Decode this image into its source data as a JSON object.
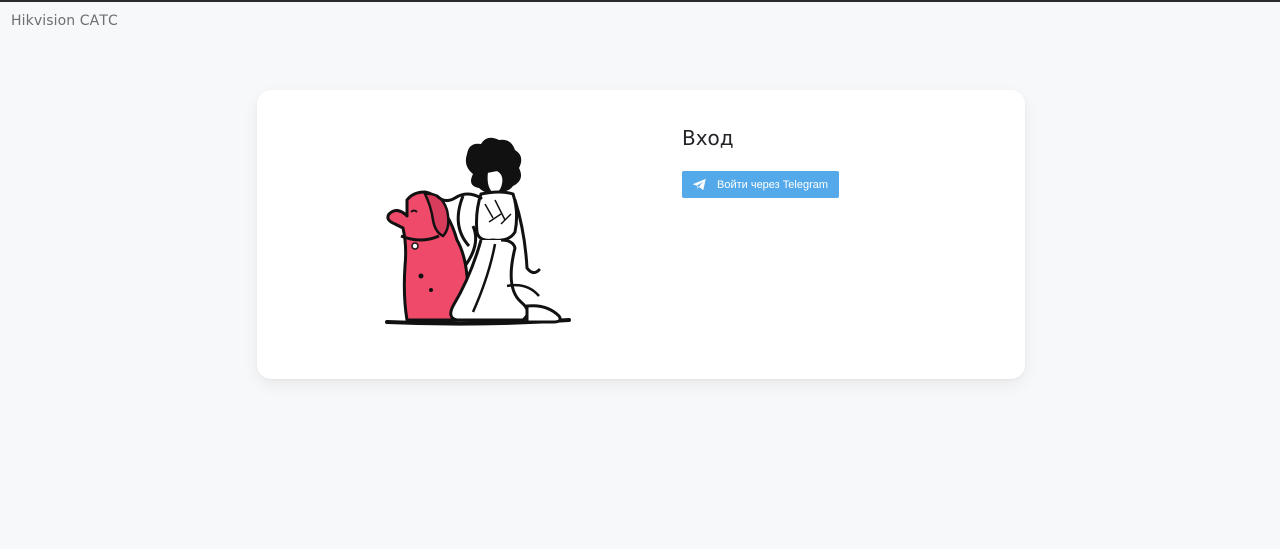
{
  "header": {
    "brand": "Hikvision САТС"
  },
  "login": {
    "title": "Вход",
    "telegram_button_label": "Войти через Telegram",
    "telegram_icon": "telegram-plane-icon"
  },
  "illustration": {
    "name": "person-with-dog-illustration"
  },
  "colors": {
    "page_background": "#f7f8f9",
    "card_background": "#ffffff",
    "telegram_blue": "#54a9eb",
    "dog_pink": "#f04a6a"
  }
}
